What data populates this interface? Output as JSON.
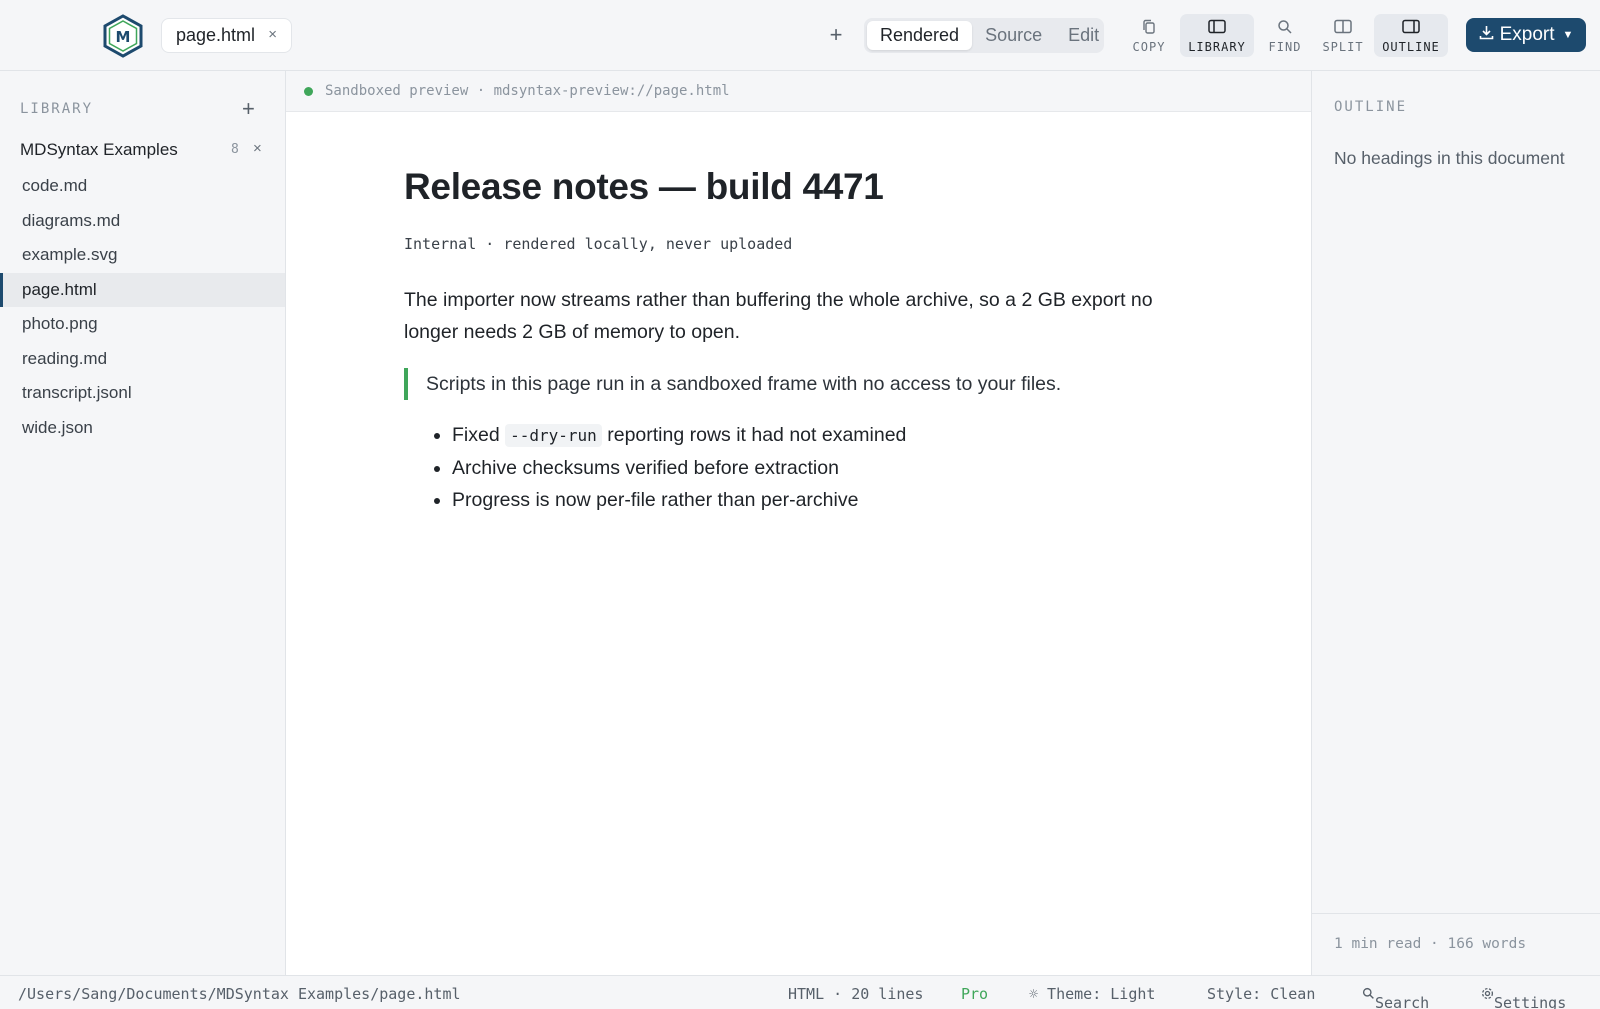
{
  "colors": {
    "accent": "#1d4a6e",
    "success": "#3fa65a",
    "text": "#1f2328",
    "muted": "#8b949e"
  },
  "app": {
    "logo_icon": "hexagon-md-logo"
  },
  "tabs": [
    {
      "label": "page.html",
      "close": "×"
    }
  ],
  "toolbar": {
    "new_tab": "+",
    "view_modes": [
      "Rendered",
      "Source",
      "Edit"
    ],
    "active_view": "Rendered",
    "tools": [
      {
        "label": "COPY",
        "icon": "copy-icon",
        "active": false
      },
      {
        "label": "LIBRARY",
        "icon": "sidebar-icon",
        "active": true
      },
      {
        "label": "FIND",
        "icon": "search-icon",
        "active": false
      },
      {
        "label": "SPLIT",
        "icon": "split-icon",
        "active": false
      },
      {
        "label": "OUTLINE",
        "icon": "outline-icon",
        "active": true
      }
    ],
    "export_label": "Export"
  },
  "sidebar": {
    "title": "LIBRARY",
    "add": "+",
    "group": {
      "name": "MDSyntax Examples",
      "count": "8",
      "close": "×"
    },
    "files": [
      "code.md",
      "diagrams.md",
      "example.svg",
      "page.html",
      "photo.png",
      "reading.md",
      "transcript.jsonl",
      "wide.json"
    ],
    "active_file": "page.html"
  },
  "preview": {
    "status": "Sandboxed preview · mdsyntax-preview://page.html"
  },
  "document": {
    "title": "Release notes — build 4471",
    "meta": "Internal · rendered locally, never uploaded",
    "paragraph": "The importer now streams rather than buffering the whole archive, so a 2 GB export no longer needs 2 GB of memory to open.",
    "quote": "Scripts in this page run in a sandboxed frame with no access to your files.",
    "list": [
      {
        "before": "Fixed ",
        "code": "--dry-run",
        "after": " reporting rows it had not examined"
      },
      {
        "before": "Archive checksums verified before extraction"
      },
      {
        "before": "Progress is now per-file rather than per-archive"
      }
    ]
  },
  "outline": {
    "title": "OUTLINE",
    "empty": "No headings in this document",
    "stats": "1 min read · 166 words"
  },
  "statusbar": {
    "path": "/Users/Sang/Documents/MDSyntax Examples/page.html",
    "format": "HTML · 20 lines",
    "plan": "Pro",
    "theme": "☼ Theme: Light",
    "style": "Style: Clean",
    "search": "Search",
    "settings": "Settings"
  }
}
